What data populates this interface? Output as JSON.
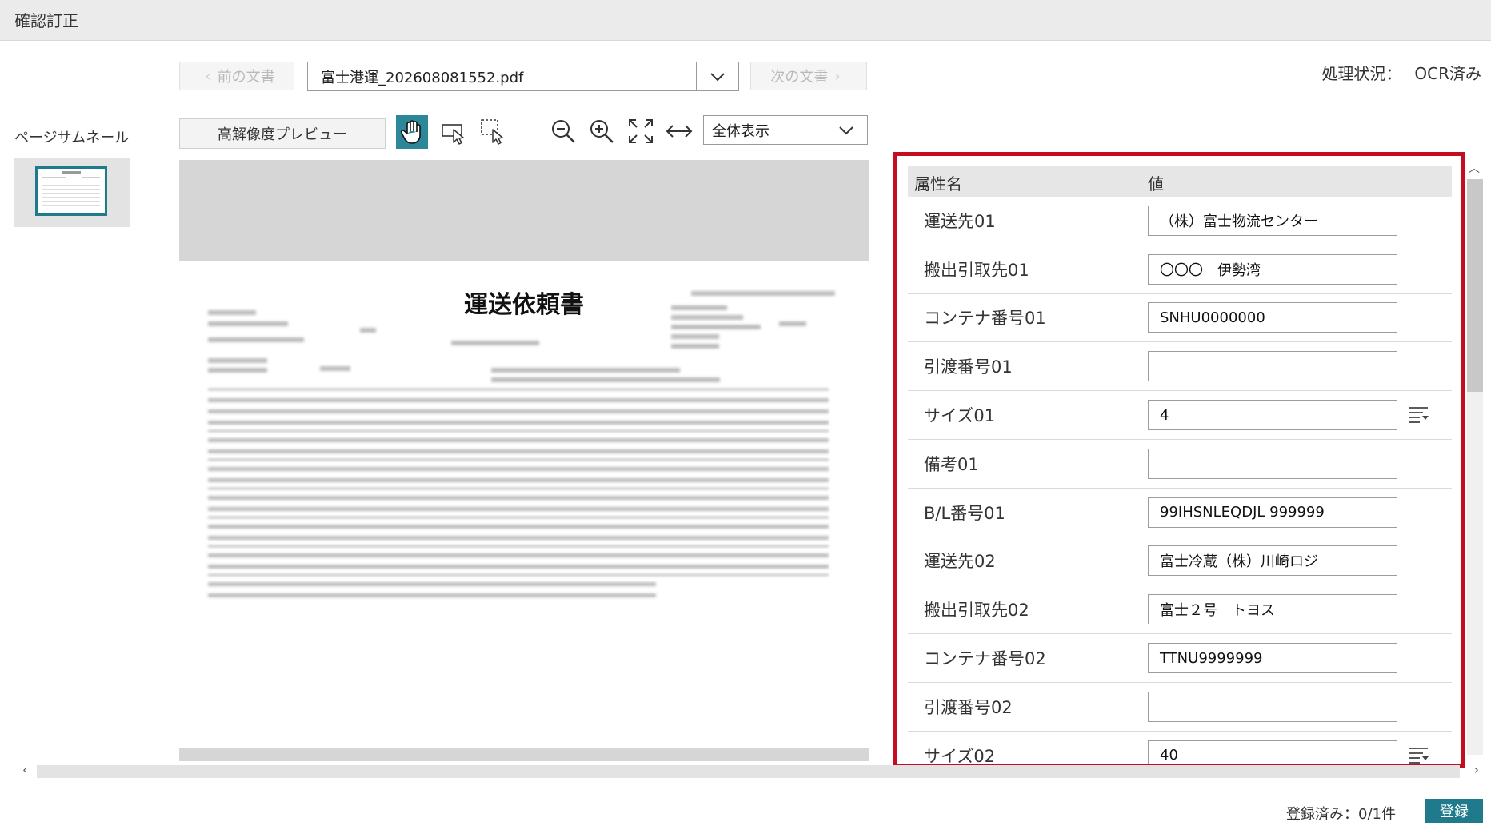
{
  "window": {
    "title": "確認訂正"
  },
  "nav": {
    "prev_label": "前の文書",
    "next_label": "次の文書",
    "file_name": "富士港運_202608081552.pdf"
  },
  "status": {
    "label": "処理状況：",
    "value": "OCR済み"
  },
  "thumbnails": {
    "label": "ページサムネール"
  },
  "toolbar": {
    "hires_preview_label": "高解像度プレビュー",
    "zoom_mode": "全体表示",
    "icons": [
      "hand-icon",
      "pointer-select-icon",
      "area-select-icon",
      "zoom-out-icon",
      "zoom-in-icon",
      "fit-page-icon",
      "fit-width-icon"
    ]
  },
  "document": {
    "title": "運送依頼書"
  },
  "attributes": {
    "header_name": "属性名",
    "header_value": "値",
    "rows": [
      {
        "name": "運送先01",
        "value": "（株）富士物流センター"
      },
      {
        "name": "搬出引取先01",
        "value": "〇〇〇　伊勢湾"
      },
      {
        "name": "コンテナ番号01",
        "value": "SNHU0000000"
      },
      {
        "name": "引渡番号01",
        "value": ""
      },
      {
        "name": "サイズ01",
        "value": "4",
        "has_list": true
      },
      {
        "name": "備考01",
        "value": ""
      },
      {
        "name": "B/L番号01",
        "value": "99IHSNLEQDJL 999999"
      },
      {
        "name": "運送先02",
        "value": "富士冷蔵（株）川崎ロジ"
      },
      {
        "name": "搬出引取先02",
        "value": "富士２号　トヨス"
      },
      {
        "name": "コンテナ番号02",
        "value": "TTNU9999999"
      },
      {
        "name": "引渡番号02",
        "value": ""
      },
      {
        "name": "サイズ02",
        "value": "40",
        "has_list": true
      }
    ]
  },
  "footer": {
    "registered_label": "登録済み：0/1件",
    "submit_label": "登録"
  },
  "colors": {
    "accent": "#1f7b8c",
    "highlight_border": "#c40d1f"
  }
}
